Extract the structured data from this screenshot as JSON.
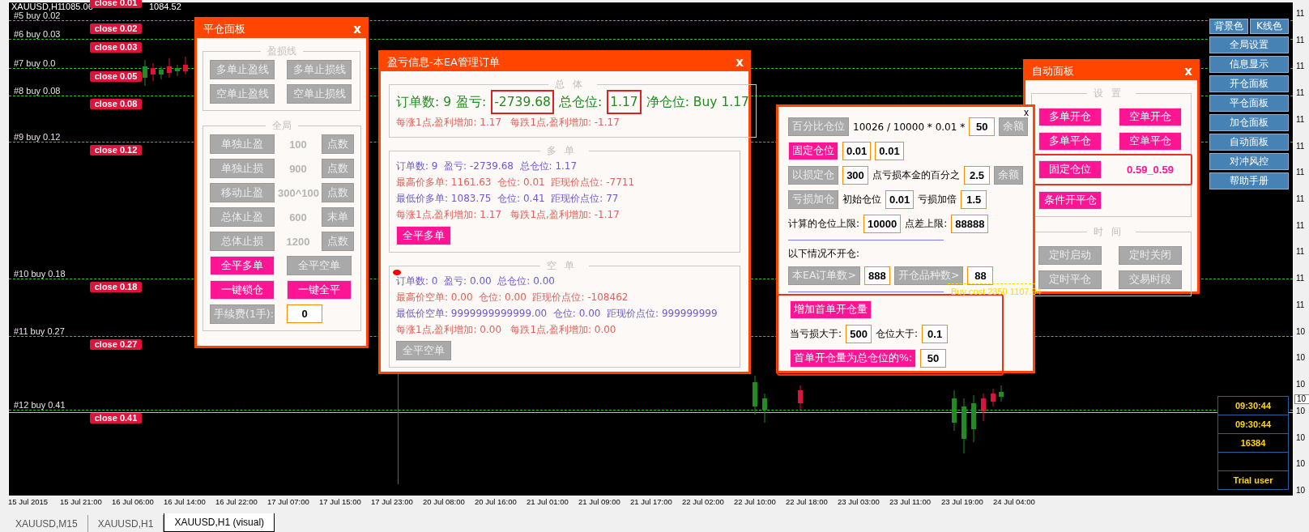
{
  "chart": {
    "symbol": "XAUUSD,H1",
    "price_open": "1085.06",
    "price_close": "1084.52",
    "top_close_label": "close 0.01",
    "orders": [
      {
        "label": "#5 buy 0.02",
        "close": "close 0.02"
      },
      {
        "label": "#6 buy 0.03",
        "close": "close 0.03"
      },
      {
        "label": "#7 buy 0.0",
        "close": "close 0.05"
      },
      {
        "label": "#8 buy 0.08",
        "close": "close 0.08"
      },
      {
        "label": "#9 buy 0.12",
        "close": "close 0.12"
      },
      {
        "label": "#10 buy 0.18",
        "close": "close 0.18"
      },
      {
        "label": "#11 buy 0.27",
        "close": "close 0.27"
      },
      {
        "label": "#12 buy 0.41",
        "close": "close 0.41"
      }
    ],
    "cost_line": "Buy cost 2350 1107.94",
    "price_axis": [
      "11",
      "11",
      "11",
      "11",
      "11",
      "11",
      "11",
      "11",
      "11",
      "11",
      "11",
      "11",
      "10",
      "10",
      "10",
      "10",
      "10",
      "10",
      "10"
    ],
    "current_price": "10",
    "time_axis": [
      "15 Jul 2015",
      "15 Jul 21:00",
      "16 Jul 06:00",
      "16 Jul 14:00",
      "16 Jul 22:00",
      "17 Jul 07:00",
      "17 Jul 15:00",
      "17 Jul 23:00",
      "20 Jul 08:00",
      "20 Jul 16:00",
      "21 Jul 01:00",
      "21 Jul 09:00",
      "21 Jul 17:00",
      "22 Jul 02:00",
      "22 Jul 10:00",
      "22 Jul 18:00",
      "23 Jul 03:00",
      "23 Jul 11:00",
      "23 Jul 19:00",
      "24 Jul 04:00"
    ]
  },
  "close_panel": {
    "title": "平仓面板",
    "close": "x",
    "lines_section": {
      "legend": "盈损线",
      "buttons": [
        {
          "label": "多单止盈线",
          "active": false
        },
        {
          "label": "多单止损线",
          "active": false
        },
        {
          "label": "空单止盈线",
          "active": false
        },
        {
          "label": "空单止损线",
          "active": false
        }
      ]
    },
    "global_section": {
      "legend": "全局",
      "settings": [
        {
          "label": "单独止盈",
          "value": "100",
          "unit": "点数"
        },
        {
          "label": "单独止损",
          "value": "900",
          "unit": "点数"
        },
        {
          "label": "移动止盈",
          "value": "300^100",
          "unit": "点数"
        },
        {
          "label": "总体止盈",
          "value": "600",
          "unit": "末单"
        },
        {
          "label": "总体止损",
          "value": "1200",
          "unit": "点数"
        }
      ],
      "buttons": [
        {
          "label": "全平多单",
          "active": true
        },
        {
          "label": "全平空单",
          "active": false
        },
        {
          "label": "一键锁仓",
          "active": true
        },
        {
          "label": "一键全平",
          "active": true
        }
      ],
      "fee": {
        "label": "手续费(1手):",
        "value": "0"
      }
    }
  },
  "pnl_panel": {
    "title": "盈亏信息-本EA管理订单",
    "close": "x",
    "sections": [
      {
        "legend": "总体",
        "summary": [
          {
            "text": "订单数: 9",
            "boxed": false
          },
          {
            "text": "盈亏:",
            "boxed": false
          },
          {
            "text": "-2739.68",
            "boxed": true
          },
          {
            "text": "总仓位:",
            "boxed": false
          },
          {
            "text": "1.17",
            "boxed": true
          },
          {
            "text": "净仓位: Buy 1.17",
            "boxed": false
          }
        ],
        "lines": [
          {
            "text": "每涨1点,盈利增加: 1.17   每跌1点,盈利增加: -1.17",
            "color": "#e0605a"
          }
        ]
      },
      {
        "legend": "多单",
        "lines": [
          {
            "text": "订单数: 9  盈亏: -2739.68  总仓位: 1.17",
            "color": "#6a5acd"
          },
          {
            "text": "最高价多单: 1161.63  仓位: 0.01  距现价点位: -7711",
            "color": "#e0605a"
          },
          {
            "text": "最低价多单: 1083.75  仓位: 0.41  距现价点位: 77",
            "color": "#6a5acd"
          },
          {
            "text": "每涨1点,盈利增加: 1.17   每跌1点,盈利增加: -1.17",
            "color": "#e0605a"
          }
        ],
        "button": {
          "label": "全平多单",
          "active": true
        }
      },
      {
        "legend": "空单",
        "marker": true,
        "lines": [
          {
            "text": "订单数: 0  盈亏: 0.00  总仓位: 0.00",
            "color": "#6a5acd"
          },
          {
            "text": "最高价空单: 0.00  仓位: 0.00  距现价点位: -108462",
            "color": "#e0605a"
          },
          {
            "text": "最低价空单: 9999999999999.00  仓位: 0.00  距现价点位: 999999999",
            "color": "#6a5acd"
          },
          {
            "text": "每涨1点,盈利增加: 0.00   每跌1点,盈利增加: 0.00",
            "color": "#e0605a"
          }
        ],
        "button": {
          "label": "全平空单",
          "active": false
        }
      }
    ]
  },
  "open_panel": {
    "close": "x",
    "groups": [
      {
        "framed": false,
        "rows": [
          {
            "items": [
              {
                "kind": "button",
                "label": "百分比仓位",
                "active": false
              },
              {
                "kind": "text",
                "label": "10026 / 10000 * 0.01 *"
              },
              {
                "kind": "input",
                "label": "50"
              },
              {
                "kind": "button",
                "label": "余额",
                "active": false
              }
            ]
          },
          {
            "items": [
              {
                "kind": "button",
                "label": "固定仓位",
                "active": true
              },
              {
                "kind": "input",
                "label": "0.01"
              },
              {
                "kind": "input",
                "label": "0.01"
              }
            ]
          },
          {
            "items": [
              {
                "kind": "button",
                "label": "以损定仓",
                "active": false
              },
              {
                "kind": "input",
                "label": "300"
              },
              {
                "kind": "text",
                "label": "点亏损本金的百分之"
              },
              {
                "kind": "input",
                "label": "2.5"
              },
              {
                "kind": "button",
                "label": "余额",
                "active": false
              }
            ]
          },
          {
            "items": [
              {
                "kind": "button",
                "label": "亏损加仓",
                "active": false
              },
              {
                "kind": "text",
                "label": "初始仓位"
              },
              {
                "kind": "input",
                "label": "0.01"
              },
              {
                "kind": "text",
                "label": "亏损加倍"
              },
              {
                "kind": "input",
                "label": "1.5"
              }
            ]
          },
          {
            "items": [
              {
                "kind": "text",
                "label": "计算的仓位上限:"
              },
              {
                "kind": "input",
                "label": "10000"
              },
              {
                "kind": "text",
                "label": "点差上限:"
              },
              {
                "kind": "input",
                "label": "88888"
              }
            ]
          }
        ]
      },
      {
        "framed": false,
        "rows": [
          {
            "items": [
              {
                "kind": "text",
                "label": "以下情况不开仓:"
              }
            ]
          },
          {
            "items": [
              {
                "kind": "button",
                "label": "本EA订单数>",
                "active": false
              },
              {
                "kind": "input",
                "label": "888"
              },
              {
                "kind": "button",
                "label": "开仓品种数>",
                "active": false
              },
              {
                "kind": "input",
                "label": "88"
              }
            ]
          }
        ]
      },
      {
        "framed": true,
        "rows": [
          {
            "items": [
              {
                "kind": "button",
                "label": "增加首单开仓量",
                "active": true
              }
            ]
          },
          {
            "items": [
              {
                "kind": "text",
                "label": "当亏损大于:"
              },
              {
                "kind": "input",
                "label": "500"
              },
              {
                "kind": "text",
                "label": "仓位大于:"
              },
              {
                "kind": "input",
                "label": "0.1"
              }
            ]
          },
          {
            "items": [
              {
                "kind": "button",
                "label": "首单开仓量为总仓位的%:",
                "active": true
              },
              {
                "kind": "input",
                "label": "50"
              }
            ]
          }
        ]
      }
    ]
  },
  "auto_panel": {
    "title": "自动面板",
    "close": "x",
    "sections": [
      {
        "legend": "设置",
        "rows": [
          {
            "framed": false,
            "items": [
              {
                "kind": "button",
                "label": "多单开仓",
                "active": true
              },
              {
                "kind": "button",
                "label": "空单开仓",
                "active": true
              }
            ]
          },
          {
            "framed": false,
            "items": [
              {
                "kind": "button",
                "label": "多单平仓",
                "active": true
              },
              {
                "kind": "button",
                "label": "空单平仓",
                "active": true
              }
            ]
          },
          {
            "framed": true,
            "items": [
              {
                "kind": "button",
                "label": "固定仓位",
                "active": true
              },
              {
                "kind": "value",
                "label": "0.59_0.59"
              }
            ]
          },
          {
            "framed": false,
            "items": [
              {
                "kind": "button",
                "label": "条件开平仓",
                "active": true
              }
            ]
          }
        ]
      },
      {
        "legend": "时间",
        "rows": [
          {
            "framed": false,
            "items": [
              {
                "kind": "button",
                "label": "定时启动",
                "active": false
              },
              {
                "kind": "button",
                "label": "定时关闭",
                "active": false
              }
            ]
          },
          {
            "framed": false,
            "items": [
              {
                "kind": "button",
                "label": "定时平仓",
                "active": false
              },
              {
                "kind": "button",
                "label": "交易时段",
                "active": false
              }
            ]
          }
        ]
      }
    ]
  },
  "side_menu": {
    "top": [
      "背景色",
      "K线色"
    ],
    "items": [
      "全局设置",
      "信息显示",
      "开仓面板",
      "平仓面板",
      "加仓面板",
      "自动面板",
      "对冲风控",
      "帮助手册"
    ]
  },
  "info_box": {
    "rows": [
      "09:30:44",
      "09:30:44",
      "16384"
    ],
    "footer": "Trial user"
  },
  "tabs": [
    {
      "label": "XAUUSD,M15",
      "selected": false
    },
    {
      "label": "XAUUSD,H1",
      "selected": false
    },
    {
      "label": "XAUUSD,H1 (visual)",
      "selected": true
    }
  ]
}
